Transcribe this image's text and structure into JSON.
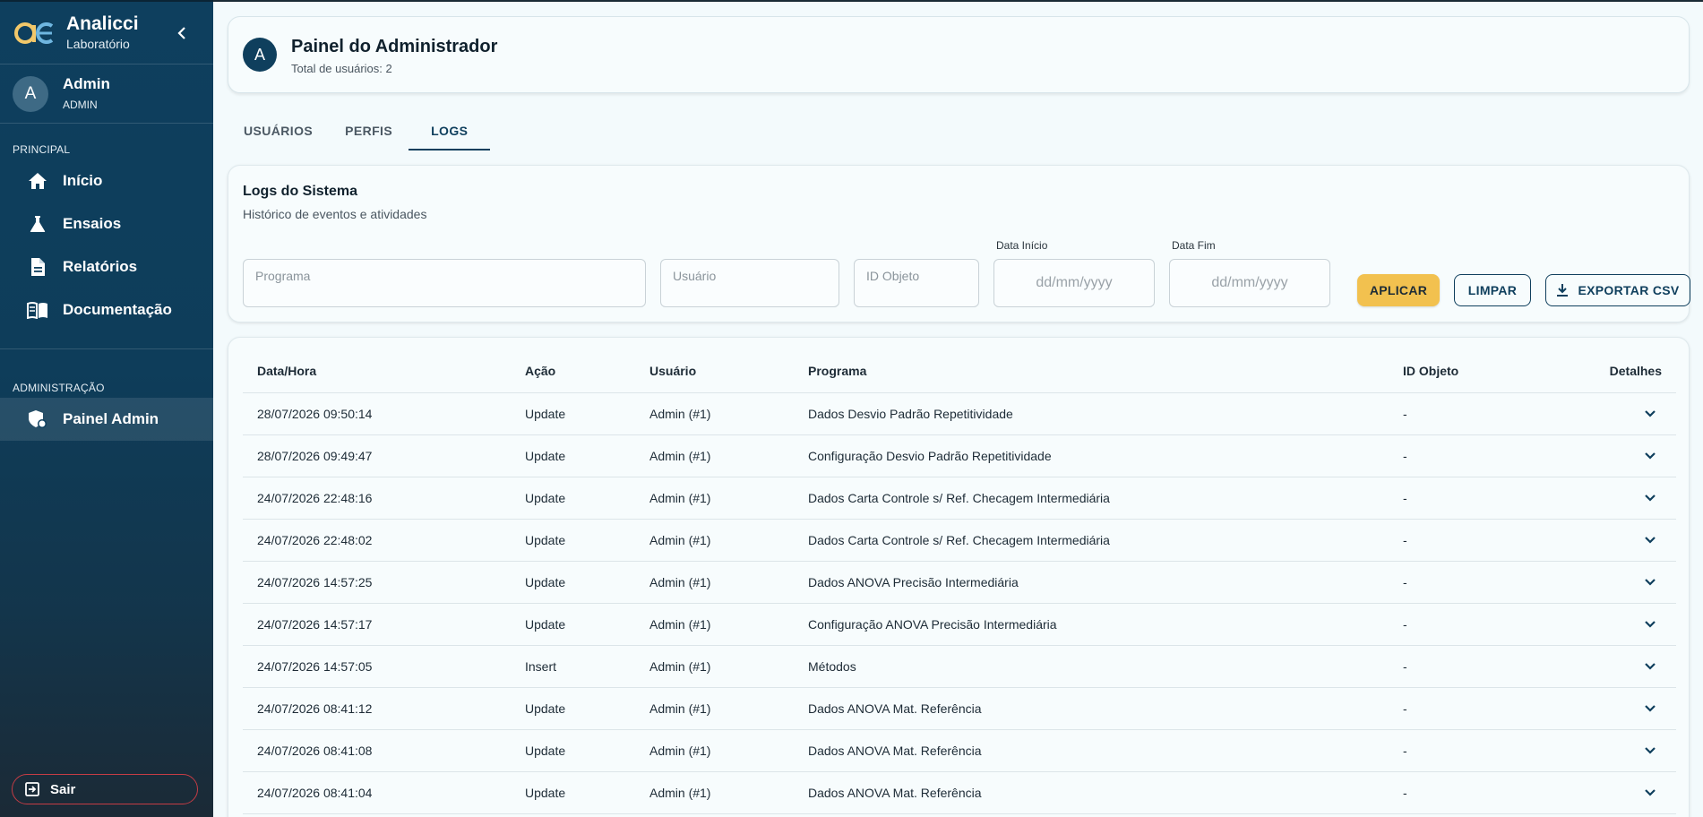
{
  "sidebar": {
    "brand_name": "Analicci",
    "brand_sub": "Laboratório",
    "user": {
      "initial": "A",
      "name": "Admin",
      "role": "ADMIN"
    },
    "section_principal": "PRINCIPAL",
    "nav": [
      {
        "label": "Início",
        "icon": "home-icon"
      },
      {
        "label": "Ensaios",
        "icon": "flask-icon"
      },
      {
        "label": "Relatórios",
        "icon": "document-icon"
      },
      {
        "label": "Documentação",
        "icon": "book-icon"
      }
    ],
    "section_admin": "ADMINISTRAÇÃO",
    "admin_nav": {
      "label": "Painel Admin",
      "icon": "admin-shield-icon"
    },
    "logout_label": "Sair"
  },
  "header": {
    "initial": "A",
    "title": "Painel do Administrador",
    "subtitle": "Total de usuários: 2"
  },
  "tabs": [
    {
      "label": "USUÁRIOS",
      "active": false
    },
    {
      "label": "PERFIS",
      "active": false
    },
    {
      "label": "LOGS",
      "active": true
    }
  ],
  "filters": {
    "title": "Logs do Sistema",
    "subtitle": "Histórico de eventos e atividades",
    "programa_placeholder": "Programa",
    "usuario_placeholder": "Usuário",
    "id_objeto_placeholder": "ID Objeto",
    "data_inicio_label": "Data Início",
    "data_inicio_placeholder": "dd/mm/yyyy",
    "data_fim_label": "Data Fim",
    "data_fim_placeholder": "dd/mm/yyyy",
    "apply_label": "APLICAR",
    "clear_label": "LIMPAR",
    "export_label": "EXPORTAR CSV"
  },
  "table": {
    "headers": [
      "Data/Hora",
      "Ação",
      "Usuário",
      "Programa",
      "ID Objeto",
      "Detalhes"
    ],
    "rows": [
      [
        "28/07/2026 09:50:14",
        "Update",
        "Admin (#1)",
        "Dados Desvio Padrão Repetitividade",
        "-"
      ],
      [
        "28/07/2026 09:49:47",
        "Update",
        "Admin (#1)",
        "Configuração Desvio Padrão Repetitividade",
        "-"
      ],
      [
        "24/07/2026 22:48:16",
        "Update",
        "Admin (#1)",
        "Dados Carta Controle s/ Ref. Checagem Intermediária",
        "-"
      ],
      [
        "24/07/2026 22:48:02",
        "Update",
        "Admin (#1)",
        "Dados Carta Controle s/ Ref. Checagem Intermediária",
        "-"
      ],
      [
        "24/07/2026 14:57:25",
        "Update",
        "Admin (#1)",
        "Dados ANOVA Precisão Intermediária",
        "-"
      ],
      [
        "24/07/2026 14:57:17",
        "Update",
        "Admin (#1)",
        "Configuração ANOVA Precisão Intermediária",
        "-"
      ],
      [
        "24/07/2026 14:57:05",
        "Insert",
        "Admin (#1)",
        "Métodos",
        "-"
      ],
      [
        "24/07/2026 08:41:12",
        "Update",
        "Admin (#1)",
        "Dados ANOVA Mat. Referência",
        "-"
      ],
      [
        "24/07/2026 08:41:08",
        "Update",
        "Admin (#1)",
        "Dados ANOVA Mat. Referência",
        "-"
      ],
      [
        "24/07/2026 08:41:04",
        "Update",
        "Admin (#1)",
        "Dados ANOVA Mat. Referência",
        "-"
      ]
    ]
  },
  "colors": {
    "sidebar_bg": "#0e3f5e",
    "primary": "#0f3f5d",
    "accent_yellow": "#f2c14f",
    "logout_border": "#c43c45",
    "page_bg": "#f3fafc"
  }
}
